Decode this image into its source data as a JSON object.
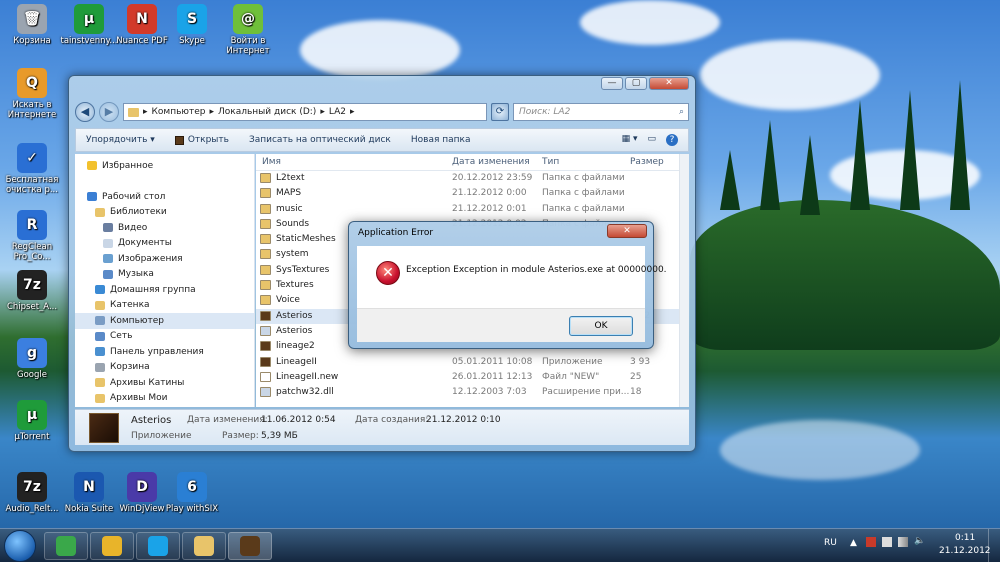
{
  "desktop": {
    "icons": [
      {
        "label": "Корзина",
        "icon": "recycle-bin-icon",
        "color": "#9aa4b0",
        "glyph": "🗑"
      },
      {
        "label": "tainstvenny...",
        "icon": "utorrent-icon",
        "color": "#1f9b3a",
        "glyph": "µ"
      },
      {
        "label": "Nuance PDF",
        "icon": "nuance-pdf-icon",
        "color": "#d23a2a",
        "glyph": "N"
      },
      {
        "label": "Skype",
        "icon": "skype-icon",
        "color": "#1aa3e8",
        "glyph": "S"
      },
      {
        "label": "Войти в Интернет",
        "icon": "internet-icon",
        "color": "#6fbf3a",
        "glyph": "@"
      },
      {
        "label": "Искать в Интернете",
        "icon": "search-internet-icon",
        "color": "#e89a2a",
        "glyph": "Q"
      },
      {
        "label": "Бесплатная очистка р...",
        "icon": "cleanup-icon",
        "color": "#2a6fd4",
        "glyph": "✓"
      },
      {
        "label": "RegClean Pro_Co...",
        "icon": "regclean-icon",
        "color": "#2a6fd4",
        "glyph": "R"
      },
      {
        "label": "Chipset_A...",
        "icon": "7zip-icon",
        "color": "#222222",
        "glyph": "7z"
      },
      {
        "label": "Google",
        "icon": "google-icon",
        "color": "#3b7fe0",
        "glyph": "g"
      },
      {
        "label": "µTorrent",
        "icon": "utorrent-icon",
        "color": "#1f9b3a",
        "glyph": "µ"
      },
      {
        "label": "Audio_Relt...",
        "icon": "7zip-icon",
        "color": "#222222",
        "glyph": "7z"
      },
      {
        "label": "Nokia Suite",
        "icon": "nokia-suite-icon",
        "color": "#1b58b0",
        "glyph": "N"
      },
      {
        "label": "WinDjView",
        "icon": "windjview-icon",
        "color": "#4a3aa8",
        "glyph": "D"
      },
      {
        "label": "Play withSIX",
        "icon": "playwithsix-icon",
        "color": "#2a7fd4",
        "glyph": "6"
      }
    ]
  },
  "explorer": {
    "window_buttons": {
      "minimize": "—",
      "maximize": "▢",
      "close": "✕"
    },
    "address": {
      "segments": [
        "Компьютер",
        "Локальный диск (D:)",
        "LA2"
      ],
      "separator": "▸"
    },
    "search_placeholder": "Поиск: LA2",
    "toolbar": {
      "organize": "Упорядочить ▾",
      "open": "Открыть",
      "burn": "Записать на оптический диск",
      "new_folder": "Новая папка"
    },
    "nav": {
      "items": [
        {
          "label": "Избранное",
          "icon": "favorites-icon",
          "color": "#f2c12e",
          "indent": 0
        },
        {
          "label": "",
          "icon": "",
          "color": "",
          "indent": 0
        },
        {
          "label": "Рабочий стол",
          "icon": "desktop-icon",
          "color": "#3b7fd4",
          "indent": 0
        },
        {
          "label": "Библиотеки",
          "icon": "libraries-icon",
          "color": "#e8c46a",
          "indent": 1
        },
        {
          "label": "Видео",
          "icon": "video-icon",
          "color": "#6a7ea0",
          "indent": 2
        },
        {
          "label": "Документы",
          "icon": "documents-icon",
          "color": "#c9d6e6",
          "indent": 2
        },
        {
          "label": "Изображения",
          "icon": "images-icon",
          "color": "#6aa0d0",
          "indent": 2
        },
        {
          "label": "Музыка",
          "icon": "music-icon",
          "color": "#5a8ac8",
          "indent": 2
        },
        {
          "label": "Домашняя группа",
          "icon": "homegroup-icon",
          "color": "#3a8ad4",
          "indent": 1
        },
        {
          "label": "Катенка",
          "icon": "user-folder-icon",
          "color": "#e8c46a",
          "indent": 1
        },
        {
          "label": "Компьютер",
          "icon": "computer-icon",
          "color": "#7a9cc4",
          "indent": 1
        },
        {
          "label": "Сеть",
          "icon": "network-icon",
          "color": "#5a8ac8",
          "indent": 1
        },
        {
          "label": "Панель управления",
          "icon": "control-panel-icon",
          "color": "#4a90d0",
          "indent": 1
        },
        {
          "label": "Корзина",
          "icon": "recycle-bin-icon",
          "color": "#9aa4b0",
          "indent": 1
        },
        {
          "label": "Архивы Катины",
          "icon": "folder-icon",
          "color": "#e8c46a",
          "indent": 1
        },
        {
          "label": "Архивы Мои",
          "icon": "folder-icon",
          "color": "#e8c46a",
          "indent": 1
        }
      ]
    },
    "columns": {
      "name": "Имя",
      "date": "Дата изменения",
      "type": "Тип",
      "size": "Размер"
    },
    "files": [
      {
        "name": "L2text",
        "date": "20.12.2012 23:59",
        "type": "Папка с файлами",
        "size": "",
        "icon": "folder-icon",
        "color": "#e8c46a"
      },
      {
        "name": "MAPS",
        "date": "21.12.2012 0:00",
        "type": "Папка с файлами",
        "size": "",
        "icon": "folder-icon",
        "color": "#e8c46a"
      },
      {
        "name": "music",
        "date": "21.12.2012 0:01",
        "type": "Папка с файлами",
        "size": "",
        "icon": "folder-icon",
        "color": "#e8c46a"
      },
      {
        "name": "Sounds",
        "date": "21.12.2012 0:02",
        "type": "Папка с файлами",
        "size": "",
        "icon": "folder-icon",
        "color": "#e8c46a"
      },
      {
        "name": "StaticMeshes",
        "date": "",
        "type": "",
        "size": "",
        "icon": "folder-icon",
        "color": "#e8c46a"
      },
      {
        "name": "system",
        "date": "",
        "type": "",
        "size": "",
        "icon": "folder-icon",
        "color": "#e8c46a"
      },
      {
        "name": "SysTextures",
        "date": "",
        "type": "",
        "size": "",
        "icon": "folder-icon",
        "color": "#e8c46a"
      },
      {
        "name": "Textures",
        "date": "",
        "type": "",
        "size": "",
        "icon": "folder-icon",
        "color": "#e8c46a"
      },
      {
        "name": "Voice",
        "date": "",
        "type": "",
        "size": "",
        "icon": "folder-icon",
        "color": "#e8c46a"
      },
      {
        "name": "Asterios",
        "date": "",
        "type": "",
        "size": "5 52",
        "icon": "lineage-exe-icon",
        "color": "#5a3a1a",
        "selected": true
      },
      {
        "name": "Asterios",
        "date": "",
        "type": "",
        "size": "",
        "icon": "config-file-icon",
        "color": "#c9d6e6"
      },
      {
        "name": "lineage2",
        "date": "",
        "type": "",
        "size": "",
        "icon": "lineage-exe-icon",
        "color": "#5a3a1a"
      },
      {
        "name": "LineageII",
        "date": "05.01.2011 10:08",
        "type": "Приложение",
        "size": "3 93",
        "icon": "lineage-exe-icon",
        "color": "#5a3a1a"
      },
      {
        "name": "LineageII.new",
        "date": "26.01.2011 12:13",
        "type": "Файл \"NEW\"",
        "size": "25",
        "icon": "file-icon",
        "color": "#ffffff"
      },
      {
        "name": "patchw32.dll",
        "date": "12.12.2003 7:03",
        "type": "Расширение при...",
        "size": "18",
        "icon": "dll-file-icon",
        "color": "#c9d6e6"
      }
    ],
    "details": {
      "name": "Asterios",
      "kind": "Приложение",
      "modified_label": "Дата изменения:",
      "modified": "11.06.2012 0:54",
      "created_label": "Дата создания:",
      "created": "21.12.2012 0:10",
      "size_label": "Размер:",
      "size": "5,39 МБ"
    }
  },
  "error_dialog": {
    "title": "Application Error",
    "message": "Exception Exception in module Asterios.exe at 00000000.",
    "ok_label": "OK",
    "close_glyph": "✕",
    "icon_glyph": "✕"
  },
  "taskbar": {
    "apps": [
      {
        "icon": "qip-icon",
        "color": "#3aa84a"
      },
      {
        "icon": "chrome-icon",
        "color": "#e8b42a"
      },
      {
        "icon": "skype-icon",
        "color": "#1aa3e8"
      },
      {
        "icon": "explorer-icon",
        "color": "#e8c46a"
      },
      {
        "icon": "lineage-icon",
        "color": "#5a3a1a"
      }
    ],
    "language": "RU",
    "time": "0:11",
    "date": "21.12.2012"
  }
}
